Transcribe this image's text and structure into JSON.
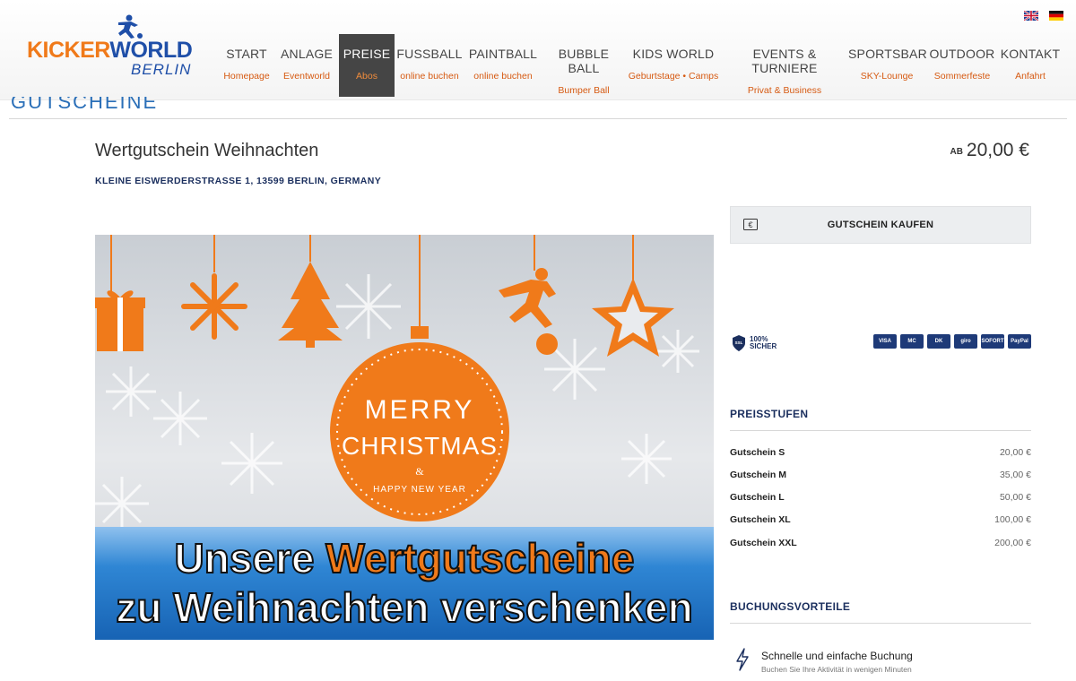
{
  "brand": {
    "logo_main_a": "KICKER",
    "logo_main_b": "WORLD",
    "logo_sub": "BERLIN"
  },
  "languages": [
    "english-flag",
    "german-flag"
  ],
  "nav": [
    {
      "label": "START",
      "sub": "Homepage",
      "active": false
    },
    {
      "label": "ANLAGE",
      "sub": "Eventworld",
      "active": false
    },
    {
      "label": "PREISE",
      "sub": "Abos",
      "active": true
    },
    {
      "label": "FUSSBALL",
      "sub": "online buchen",
      "active": false
    },
    {
      "label": "PAINTBALL",
      "sub": "online buchen",
      "active": false
    },
    {
      "label": "BUBBLE BALL",
      "sub": "Bumper Ball",
      "active": false
    },
    {
      "label": "KIDS WORLD",
      "sub": "Geburtstage • Camps",
      "active": false
    },
    {
      "label": "EVENTS & TURNIERE",
      "sub": "Privat & Business",
      "active": false
    },
    {
      "label": "SPORTSBAR",
      "sub": "SKY-Lounge",
      "active": false
    },
    {
      "label": "OUTDOOR",
      "sub": "Sommerfeste",
      "active": false
    },
    {
      "label": "KONTAKT",
      "sub": "Anfahrt",
      "active": false
    }
  ],
  "page": {
    "cut_title": "GUTSCHEINE",
    "product_title": "Wertgutschein Weihnachten",
    "address": "KLEINE EISWERDERSTRASSE 1, 13599 BERLIN, GERMANY",
    "price_prefix": "AB",
    "price": "20,00 €"
  },
  "hero": {
    "line1_a": "Unsere ",
    "line1_b": "Wertgutscheine",
    "line2": "zu Weihnachten verschenken",
    "bauble_1": "MERRY",
    "bauble_2": "CHRISTMAS",
    "bauble_3": "&",
    "bauble_4": "HAPPY NEW YEAR"
  },
  "sidebar": {
    "buy_label": "GUTSCHEIN KAUFEN",
    "ssl_1": "100%",
    "ssl_2": "SICHER",
    "ssl_badge": "SSL",
    "payments": [
      "VISA",
      "MC",
      "DK",
      "giro",
      "SOFORT",
      "PayPal"
    ],
    "tiers_heading": "PREISSTUFEN",
    "tiers": [
      {
        "name": "Gutschein S",
        "price": "20,00 €"
      },
      {
        "name": "Gutschein M",
        "price": "35,00 €"
      },
      {
        "name": "Gutschein L",
        "price": "50,00 €"
      },
      {
        "name": "Gutschein XL",
        "price": "100,00 €"
      },
      {
        "name": "Gutschein XXL",
        "price": "200,00 €"
      }
    ],
    "advantages_heading": "BUCHUNGSVORTEILE",
    "advantage_title": "Schnelle und einfache Buchung",
    "advantage_sub": "Buchen Sie Ihre Aktivität in wenigen Minuten"
  },
  "colors": {
    "brand_orange": "#f07a1a",
    "brand_blue": "#1f4fa8",
    "navy": "#1b2f5e"
  }
}
